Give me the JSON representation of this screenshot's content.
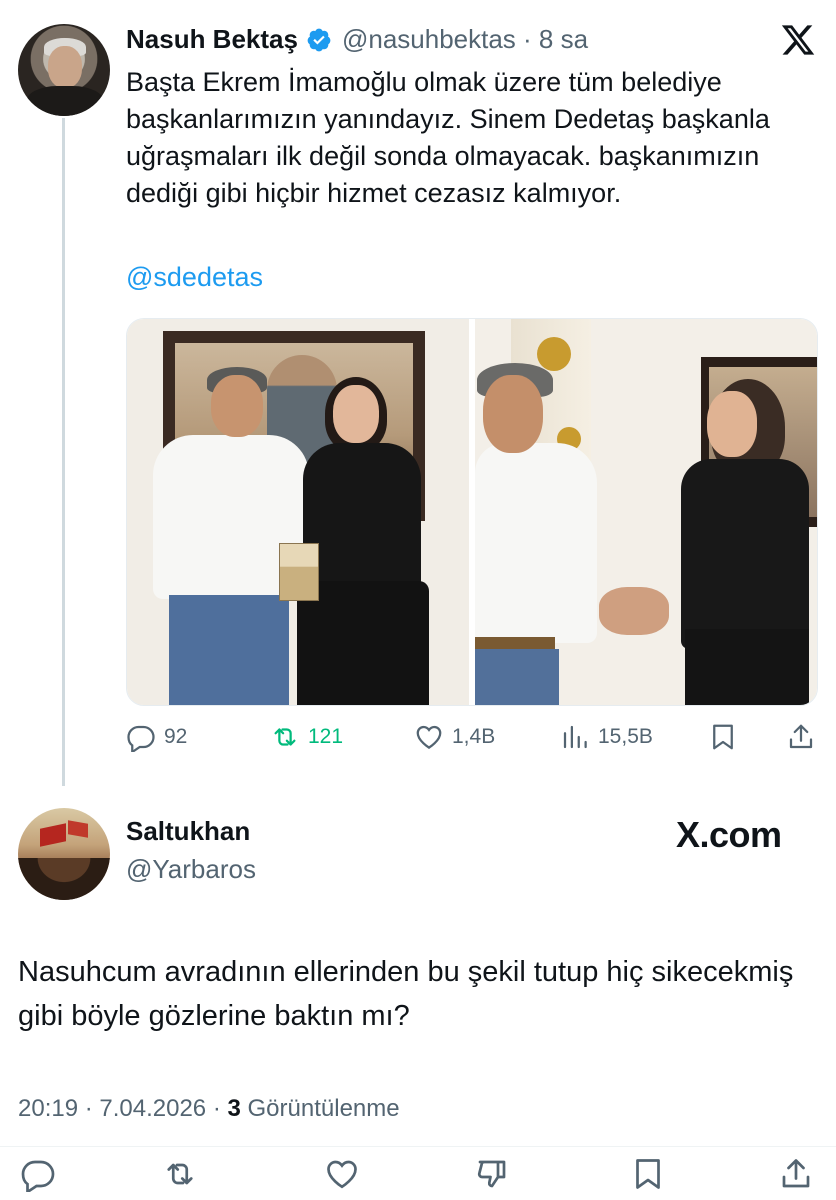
{
  "tweet": {
    "author_name": "Nasuh Bektaş",
    "author_handle": "@nasuhbektas · 8 sa",
    "text": "Başta Ekrem İmamoğlu olmak üzere tüm belediye başkanlarımızın yanındayız. Sinem Dedetaş başkanla uğraşmaları ilk değil sonda olmayacak. başkanımızın dediği gibi hiçbir hizmet cezasız kalmıyor.",
    "mention": "@sdedetas",
    "stats": {
      "replies": "92",
      "retweets": "121",
      "likes": "1,4B",
      "views": "15,5B"
    }
  },
  "reply": {
    "author_name": "Saltukhan",
    "author_handle": "@Yarbaros",
    "watermark": "X.com",
    "text": "Nasuhcum avradının ellerinden bu şekil tutup hiç sikecekmiş gibi böyle gözlerine baktın mı?",
    "time": "20:19 · 7.04.2026 · ",
    "views_count": "3",
    "views_label": " Görüntülenme"
  },
  "colors": {
    "accent": "#1d9bf0",
    "retweet": "#00ba7c",
    "muted": "#536471",
    "text": "#0f1419"
  },
  "icons": {
    "verified": "verified-badge-icon",
    "x_logo": "x-logo-icon",
    "reply": "reply-icon",
    "retweet": "retweet-icon",
    "like": "heart-icon",
    "dislike": "dislike-icon",
    "views": "views-icon",
    "bookmark": "bookmark-icon",
    "share": "share-icon"
  }
}
